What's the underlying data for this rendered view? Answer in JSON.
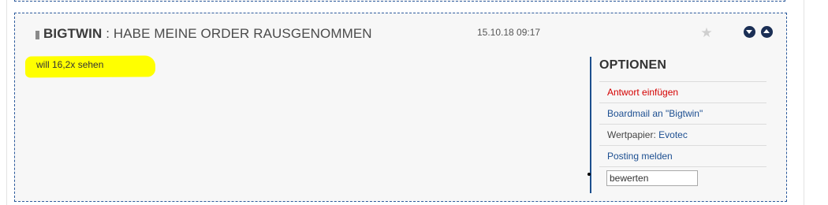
{
  "post": {
    "author": "BIGTWIN",
    "separator": ":",
    "title": "HABE MEINE ORDER RAUSGENOMMEN",
    "date": "15.10.18 09:17",
    "body": "will 16,2x sehen"
  },
  "options": {
    "heading": "OPTIONEN",
    "reply_label": "Antwort einfügen",
    "boardmail_label": "Boardmail an \"Bigtwin\"",
    "security_label": "Wertpapier:",
    "security_value": "Evotec",
    "report_label": "Posting melden",
    "rating_value": "bewerten"
  },
  "icons": {
    "star": "star-icon",
    "next": "arrow-down-circle-icon",
    "prev": "arrow-up-circle-icon"
  },
  "colors": {
    "border": "#2c5a9c",
    "link": "#1d4f91",
    "reply": "#d40000",
    "highlight": "#ffff00",
    "nav": "#1b2f55"
  }
}
